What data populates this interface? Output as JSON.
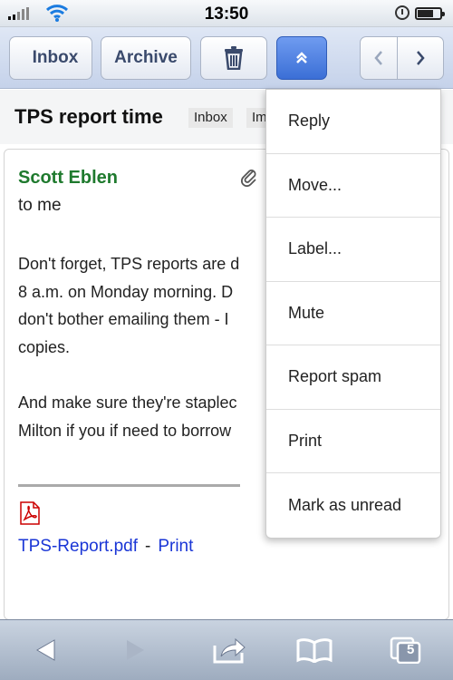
{
  "status_bar": {
    "time": "13:50"
  },
  "toolbar": {
    "inbox_label": "Inbox",
    "archive_label": "Archive",
    "icons": [
      "trash-icon",
      "double-chevron-up-icon",
      "chevron-left-icon",
      "chevron-right-icon"
    ],
    "accent_color": "#3b6fd6"
  },
  "message": {
    "subject": "TPS report time",
    "labels": [
      "Inbox",
      "Im"
    ],
    "sender": "Scott Eblen",
    "recipient": "to me",
    "body_lines": [
      [
        "Don't forget, TPS reports are d",
        "8 a.m. on Monday morning.  D",
        "don't bother emailing them - I",
        "copies."
      ],
      [
        "And make sure they're staplec",
        "Milton if you if need to borrow"
      ]
    ],
    "attachment": {
      "filename": "TPS-Report.pdf",
      "separator": "-",
      "print_label": "Print"
    },
    "sender_color": "#1f7a2e",
    "link_color": "#1a36d6"
  },
  "menu": {
    "items": [
      "Reply",
      "Move...",
      "Label...",
      "Mute",
      "Report spam",
      "Print",
      "Mark as unread"
    ]
  },
  "browser_bar": {
    "tab_count": "5",
    "icons": [
      "back-icon",
      "forward-icon",
      "share-icon",
      "bookmarks-icon",
      "tabs-icon"
    ]
  }
}
